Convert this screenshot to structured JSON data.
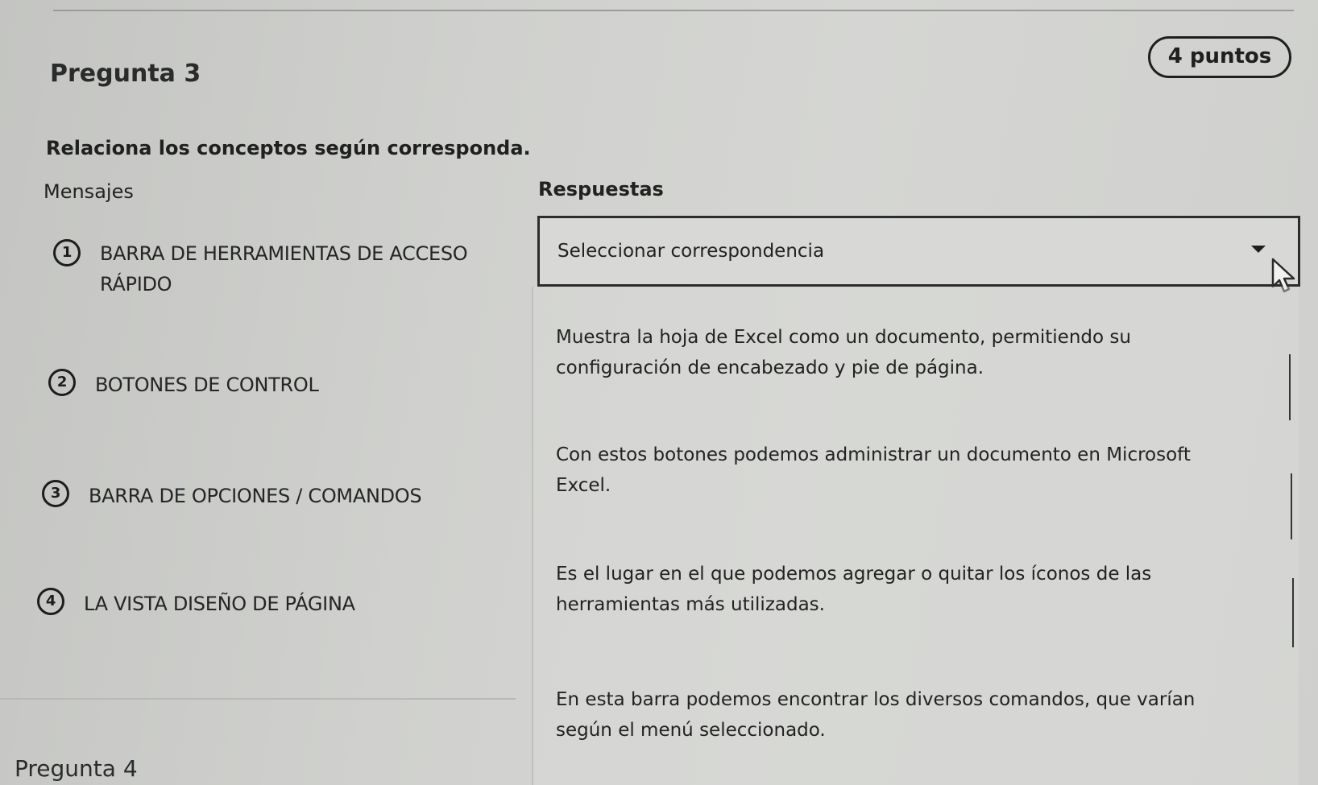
{
  "question": {
    "title": "Pregunta 3",
    "points": "4 puntos",
    "instruction": "Relaciona los conceptos según corresponda."
  },
  "columns": {
    "left_header": "Mensajes",
    "right_header": "Respuestas"
  },
  "messages": [
    {
      "number": "1",
      "line1": "BARRA DE HERRAMIENTAS DE ACCESO",
      "line2": "RÁPIDO"
    },
    {
      "number": "2",
      "line1": "BOTONES DE CONTROL"
    },
    {
      "number": "3",
      "line1": "BARRA DE OPCIONES / COMANDOS"
    },
    {
      "number": "4",
      "line1": "LA VISTA DISEÑO DE PÁGINA"
    }
  ],
  "select": {
    "value": "Seleccionar correspondencia",
    "icon": "chevron-down-icon"
  },
  "options": [
    {
      "line1": "Muestra la hoja de Excel como un documento, permitiendo su",
      "line2": "configuración de encabezado y pie de página."
    },
    {
      "line1": "Con estos botones podemos administrar un documento en Microsoft",
      "line2": "Excel."
    },
    {
      "line1": "Es el lugar en el que podemos agregar o quitar los íconos de las",
      "line2": "herramientas más utilizadas."
    },
    {
      "line1": "En esta barra podemos encontrar los diversos comandos, que varían",
      "line2": "según el menú seleccionado."
    }
  ],
  "next_question": {
    "title": "Pregunta 4"
  }
}
